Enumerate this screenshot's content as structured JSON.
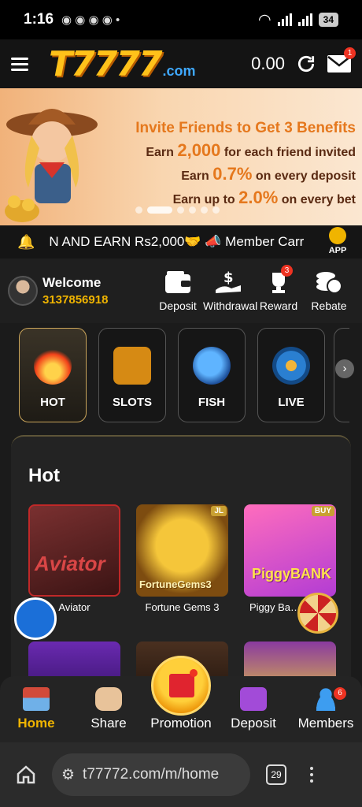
{
  "status": {
    "time": "1:16",
    "battery": "34"
  },
  "header": {
    "balance": "0.00",
    "mail_badge": "1",
    "logo_main": "T7777",
    "logo_domain": ".com"
  },
  "banner": {
    "title": "Invite Friends to Get 3 Benefits",
    "row1_pre": "Earn ",
    "row1_val": "2,000",
    "row1_post": " for each friend invited",
    "row2_pre": "Earn ",
    "row2_val": "0.7%",
    "row2_post": " on every deposit",
    "row3_pre": "Earn up to ",
    "row3_val": "2.0%",
    "row3_post": " on every bet"
  },
  "marquee": {
    "text": "N AND EARN Rs2,000🤝    📣 Member Carr",
    "app_label": "APP"
  },
  "welcome": {
    "label": "Welcome",
    "user_id": "3137856918",
    "actions": [
      {
        "label": "Deposit"
      },
      {
        "label": "Withdrawal"
      },
      {
        "label": "Reward",
        "badge": "3"
      },
      {
        "label": "Rebate"
      }
    ]
  },
  "categories": [
    {
      "label": "HOT"
    },
    {
      "label": "SLOTS"
    },
    {
      "label": "FISH"
    },
    {
      "label": "LIVE"
    }
  ],
  "hot": {
    "title": "Hot",
    "games": [
      {
        "name": "Aviator",
        "art": "Aviator"
      },
      {
        "name": "Fortune Gems 3",
        "art": "FortuneGems3",
        "tag": "JL"
      },
      {
        "name": "Piggy Bank - TapTap",
        "display": "Piggy Ba… TapTa",
        "art": "PiggyBANK",
        "tag": "BUY"
      }
    ]
  },
  "bottom_nav": [
    {
      "label": "Home"
    },
    {
      "label": "Share"
    },
    {
      "label": "Promotion"
    },
    {
      "label": "Deposit"
    },
    {
      "label": "Members",
      "badge": "6"
    }
  ],
  "browser": {
    "url": "t77772.com/m/home",
    "tab_count": "29"
  },
  "colors": {
    "accent": "#f0b400",
    "background": "#1b1b1b",
    "badge": "#ee3322"
  }
}
